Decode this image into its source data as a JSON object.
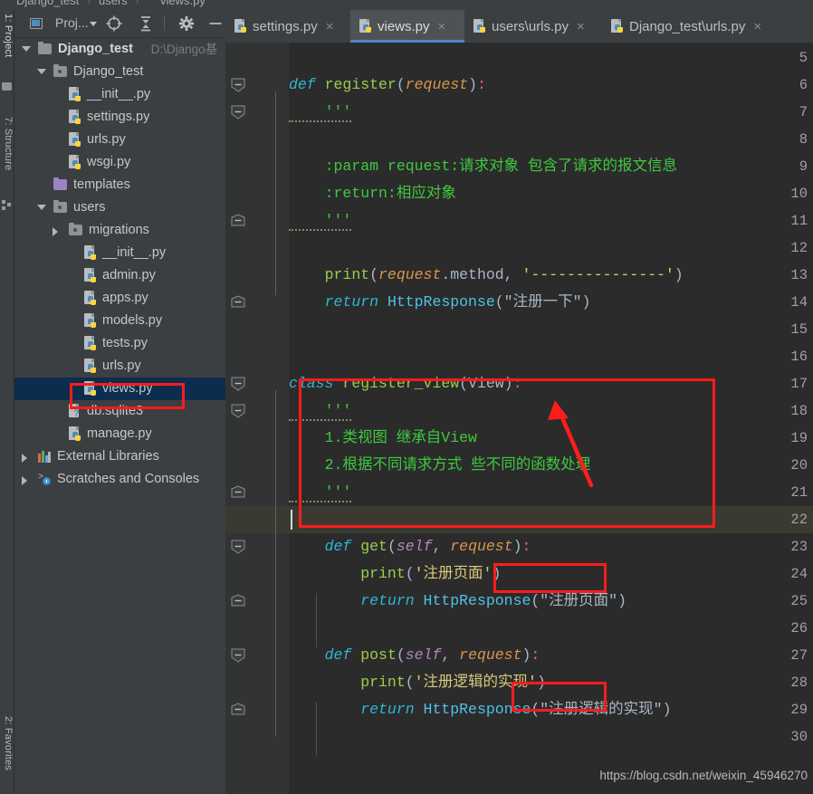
{
  "window": {
    "breadcrumb": [
      "Django_test",
      "users",
      "views.py"
    ]
  },
  "left_tool_strip": {
    "tabs": [
      {
        "label": "1: Project",
        "icon": "folder-icon",
        "active": true
      },
      {
        "label": "7: Structure",
        "icon": "structure-icon",
        "active": false
      },
      {
        "label": "2: Favorites",
        "icon": "star-icon",
        "active": false
      }
    ]
  },
  "project_toolbar": {
    "view_label": "Proj...",
    "buttons": [
      {
        "name": "select-opened-file",
        "icon": "crosshair-icon"
      },
      {
        "name": "collapse-all",
        "icon": "collapse-all-icon"
      },
      {
        "name": "settings",
        "icon": "gear-icon"
      },
      {
        "name": "hide",
        "icon": "minus-icon"
      }
    ]
  },
  "project_tree": [
    {
      "label": "Django_test",
      "path_hint": "D:\\Django基",
      "indent": 0,
      "icon": "folder-gray",
      "state": "expanded",
      "bold": true,
      "selected": false
    },
    {
      "label": "Django_test",
      "path_hint": "",
      "indent": 1,
      "icon": "module-folder",
      "state": "expanded",
      "bold": false,
      "selected": false
    },
    {
      "label": "__init__.py",
      "path_hint": "",
      "indent": 2,
      "icon": "python-file",
      "state": "leaf",
      "bold": false,
      "selected": false
    },
    {
      "label": "settings.py",
      "path_hint": "",
      "indent": 2,
      "icon": "python-file",
      "state": "leaf",
      "bold": false,
      "selected": false
    },
    {
      "label": "urls.py",
      "path_hint": "",
      "indent": 2,
      "icon": "python-file",
      "state": "leaf",
      "bold": false,
      "selected": false
    },
    {
      "label": "wsgi.py",
      "path_hint": "",
      "indent": 2,
      "icon": "python-file",
      "state": "leaf",
      "bold": false,
      "selected": false
    },
    {
      "label": "templates",
      "path_hint": "",
      "indent": 1,
      "icon": "folder-purple",
      "state": "leaf",
      "bold": false,
      "selected": false
    },
    {
      "label": "users",
      "path_hint": "",
      "indent": 1,
      "icon": "module-folder",
      "state": "expanded",
      "bold": false,
      "selected": false
    },
    {
      "label": "migrations",
      "path_hint": "",
      "indent": 2,
      "icon": "module-folder",
      "state": "collapsed",
      "bold": false,
      "selected": false
    },
    {
      "label": "__init__.py",
      "path_hint": "",
      "indent": 3,
      "icon": "python-file",
      "state": "leaf",
      "bold": false,
      "selected": false
    },
    {
      "label": "admin.py",
      "path_hint": "",
      "indent": 3,
      "icon": "python-file",
      "state": "leaf",
      "bold": false,
      "selected": false
    },
    {
      "label": "apps.py",
      "path_hint": "",
      "indent": 3,
      "icon": "python-file",
      "state": "leaf",
      "bold": false,
      "selected": false
    },
    {
      "label": "models.py",
      "path_hint": "",
      "indent": 3,
      "icon": "python-file",
      "state": "leaf",
      "bold": false,
      "selected": false
    },
    {
      "label": "tests.py",
      "path_hint": "",
      "indent": 3,
      "icon": "python-file",
      "state": "leaf",
      "bold": false,
      "selected": false
    },
    {
      "label": "urls.py",
      "path_hint": "",
      "indent": 3,
      "icon": "python-file",
      "state": "leaf",
      "bold": false,
      "selected": false
    },
    {
      "label": "views.py",
      "path_hint": "",
      "indent": 3,
      "icon": "python-file",
      "state": "leaf",
      "bold": false,
      "selected": true
    },
    {
      "label": "db.sqlite3",
      "path_hint": "",
      "indent": 2,
      "icon": "db-file",
      "state": "leaf",
      "bold": false,
      "selected": false
    },
    {
      "label": "manage.py",
      "path_hint": "",
      "indent": 2,
      "icon": "python-file",
      "state": "leaf",
      "bold": false,
      "selected": false
    },
    {
      "label": "External Libraries",
      "path_hint": "",
      "indent": 0,
      "icon": "libraries",
      "state": "collapsed",
      "bold": false,
      "selected": false
    },
    {
      "label": "Scratches and Consoles",
      "path_hint": "",
      "indent": 0,
      "icon": "scratches",
      "state": "collapsed",
      "bold": false,
      "selected": false
    }
  ],
  "editor_tabs": [
    {
      "label": "settings.py",
      "icon": "python-file",
      "active": false,
      "close": "×"
    },
    {
      "label": "views.py",
      "icon": "python-file",
      "active": true,
      "close": "×"
    },
    {
      "label": "users\\urls.py",
      "icon": "python-file",
      "active": false,
      "close": "×"
    },
    {
      "label": "Django_test\\urls.py",
      "icon": "python-file",
      "active": false,
      "close": "×"
    }
  ],
  "editor": {
    "first_line_number": 5,
    "caret_line": 22,
    "lines": [
      {
        "n": 5,
        "text": ""
      },
      {
        "n": 6,
        "text": "def register(request):"
      },
      {
        "n": 7,
        "text": "    '''"
      },
      {
        "n": 8,
        "text": ""
      },
      {
        "n": 9,
        "text": "    :param request:请求对象 包含了请求的报文信息"
      },
      {
        "n": 10,
        "text": "    :return:相应对象"
      },
      {
        "n": 11,
        "text": "    '''"
      },
      {
        "n": 12,
        "text": ""
      },
      {
        "n": 13,
        "text": "    print(request.method, '---------------')"
      },
      {
        "n": 14,
        "text": "    return HttpResponse(\"注册一下\")"
      },
      {
        "n": 15,
        "text": ""
      },
      {
        "n": 16,
        "text": ""
      },
      {
        "n": 17,
        "text": "class register_view(View):"
      },
      {
        "n": 18,
        "text": "    '''"
      },
      {
        "n": 19,
        "text": "    1.类视图 继承自View"
      },
      {
        "n": 20,
        "text": "    2.根据不同请求方式 些不同的函数处理"
      },
      {
        "n": 21,
        "text": "    '''"
      },
      {
        "n": 22,
        "text": ""
      },
      {
        "n": 23,
        "text": "    def get(self, request):"
      },
      {
        "n": 24,
        "text": "        print('注册页面')"
      },
      {
        "n": 25,
        "text": "        return HttpResponse(\"注册页面\")"
      },
      {
        "n": 26,
        "text": ""
      },
      {
        "n": 27,
        "text": "    def post(self, request):"
      },
      {
        "n": 28,
        "text": "        print('注册逻辑的实现')"
      },
      {
        "n": 29,
        "text": "        return HttpResponse(\"注册逻辑的实现\")"
      },
      {
        "n": 30,
        "text": ""
      }
    ]
  },
  "annotations": {
    "color": "#ff1c1c",
    "boxes": [
      {
        "name": "class-block-highlight",
        "target": "class register_view(View) docstring block"
      },
      {
        "name": "views-py-tree-highlight",
        "target": "views.py in project tree"
      },
      {
        "name": "get-request-param-highlight",
        "target": "request param of get()"
      },
      {
        "name": "post-request-param-highlight",
        "target": "request param of post()"
      }
    ],
    "arrow": {
      "name": "class-pointer-arrow",
      "points_to": "class register_view(View)"
    }
  },
  "watermark": {
    "text": "https://blog.csdn.net/weixin_45946270"
  }
}
